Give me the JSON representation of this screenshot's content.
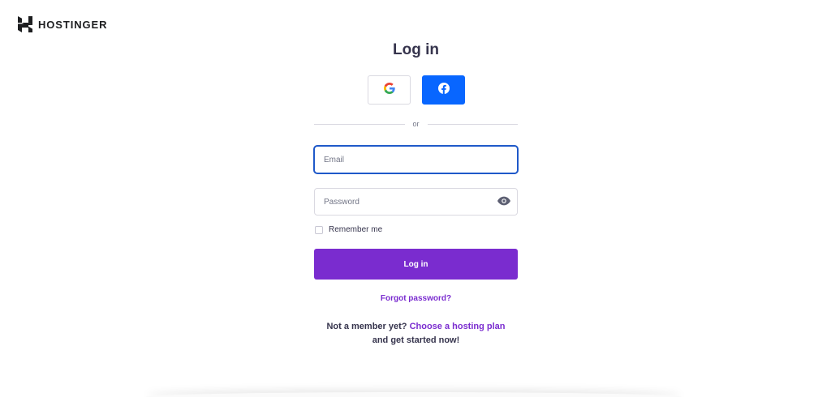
{
  "brand": {
    "name": "HOSTINGER",
    "logo_icon": "hostinger-logo-icon"
  },
  "login": {
    "title": "Log in",
    "social": {
      "google_icon": "google-icon",
      "facebook_icon": "facebook-icon"
    },
    "divider_text": "or",
    "email": {
      "value": "",
      "placeholder": "Email"
    },
    "password": {
      "value": "",
      "placeholder": "Password",
      "toggle_icon": "eye-icon"
    },
    "remember_label": "Remember me",
    "remember_checked": false,
    "submit_label": "Log in",
    "forgot_label": "Forgot password?",
    "signup": {
      "prefix": "Not a member yet?",
      "link": "Choose a hosting plan",
      "suffix": "and get started now!"
    }
  },
  "colors": {
    "primary": "#7a2ccf",
    "facebook": "#0866ff",
    "focus_border": "#1f59c9",
    "text": "#36344d"
  }
}
